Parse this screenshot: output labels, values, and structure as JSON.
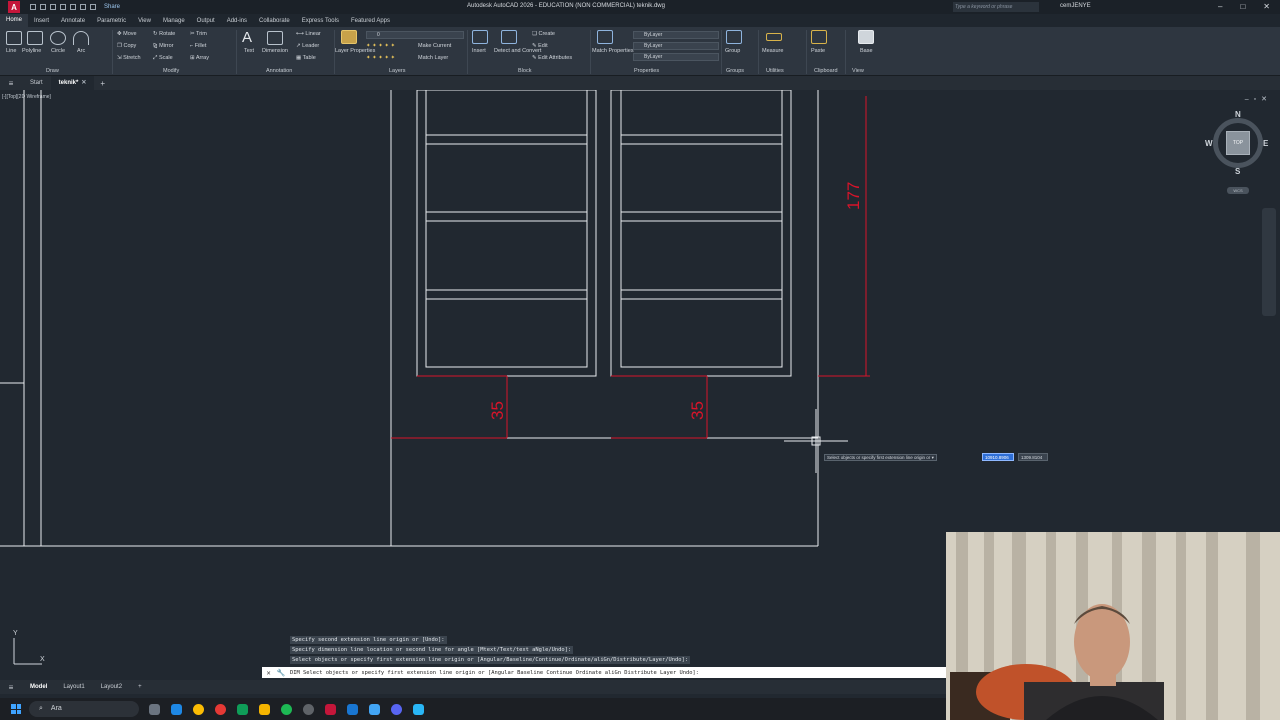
{
  "titlebar": {
    "logo": "A",
    "share": "Share",
    "title": "Autodesk AutoCAD 2026 - EDUCATION (NON COMMERCIAL)   teknik.dwg",
    "search_placeholder": "Type a keyword or phrase",
    "user": "cemJENYE"
  },
  "menu_tabs": [
    "Home",
    "Insert",
    "Annotate",
    "Parametric",
    "View",
    "Manage",
    "Output",
    "Add-ins",
    "Collaborate",
    "Express Tools",
    "Featured Apps"
  ],
  "ribbon": {
    "draw": {
      "line": "Line",
      "polyline": "Polyline",
      "circle": "Circle",
      "arc": "Arc",
      "label": "Draw"
    },
    "modify": {
      "move": "Move",
      "rotate": "Rotate",
      "trim": "Trim",
      "copy": "Copy",
      "mirror": "Mirror",
      "fillet": "Fillet",
      "stretch": "Stretch",
      "scale": "Scale",
      "array": "Array",
      "label": "Modify"
    },
    "annotation": {
      "text": "Text",
      "dimension": "Dimension",
      "linear": "Linear",
      "leader": "Leader",
      "table": "Table",
      "label": "Annotation"
    },
    "layers": {
      "layer_properties": "Layer Properties",
      "make_current": "Make Current",
      "match_layer": "Match Layer",
      "current_layer": "0",
      "label": "Layers"
    },
    "block": {
      "insert": "Insert",
      "detect_convert": "Detect and Convert",
      "create": "Create",
      "edit": "Edit",
      "edit_attributes": "Edit Attributes",
      "label": "Block"
    },
    "properties": {
      "match_properties": "Match Properties",
      "bylayer1": "ByLayer",
      "bylayer2": "ByLayer",
      "bylayer3": "ByLayer",
      "label": "Properties"
    },
    "groups": {
      "group": "Group",
      "label": "Groups"
    },
    "utilities": {
      "measure": "Measure",
      "label": "Utilities"
    },
    "clipboard": {
      "paste": "Paste",
      "label": "Clipboard"
    },
    "view": {
      "base": "Base",
      "label": "View"
    }
  },
  "file_tabs": {
    "start": "Start",
    "active": "teknik*"
  },
  "viewport": {
    "label": "[-][Top][2D Wireframe]",
    "viewcube": {
      "n": "N",
      "s": "S",
      "e": "E",
      "w": "W",
      "face": "TOP",
      "wcs": "WCS"
    },
    "dimensions": {
      "vertical": "177",
      "left": "35",
      "right": "35"
    }
  },
  "colors": {
    "dimension": "#d8142a",
    "geometry": "#e9ecef",
    "background": "#212830",
    "highlight": "#2f6fd6"
  },
  "dynamic_input": {
    "prompt": "Select objects or specify first extension line origin or",
    "value1": "10910.8906",
    "value2": "1309.8104"
  },
  "command": {
    "history": [
      "Specify second extension line origin or [Undo]:",
      "Specify dimension line location or second line for angle [Mtext/Text/text aNgle/Undo]:",
      "Select objects or specify first extension line origin or [Angular/Baseline/Continue/Ordinate/aliGn/Distribute/Layer/Undo]:"
    ],
    "current": "DIM Select objects or specify first extension line origin or [Angular Baseline Continue Ordinate aliGn Distribute Layer Undo]:"
  },
  "ucs": {
    "x": "X",
    "y": "Y"
  },
  "layout_tabs": [
    "Model",
    "Layout1",
    "Layout2"
  ],
  "taskbar": {
    "search": "Ara"
  }
}
